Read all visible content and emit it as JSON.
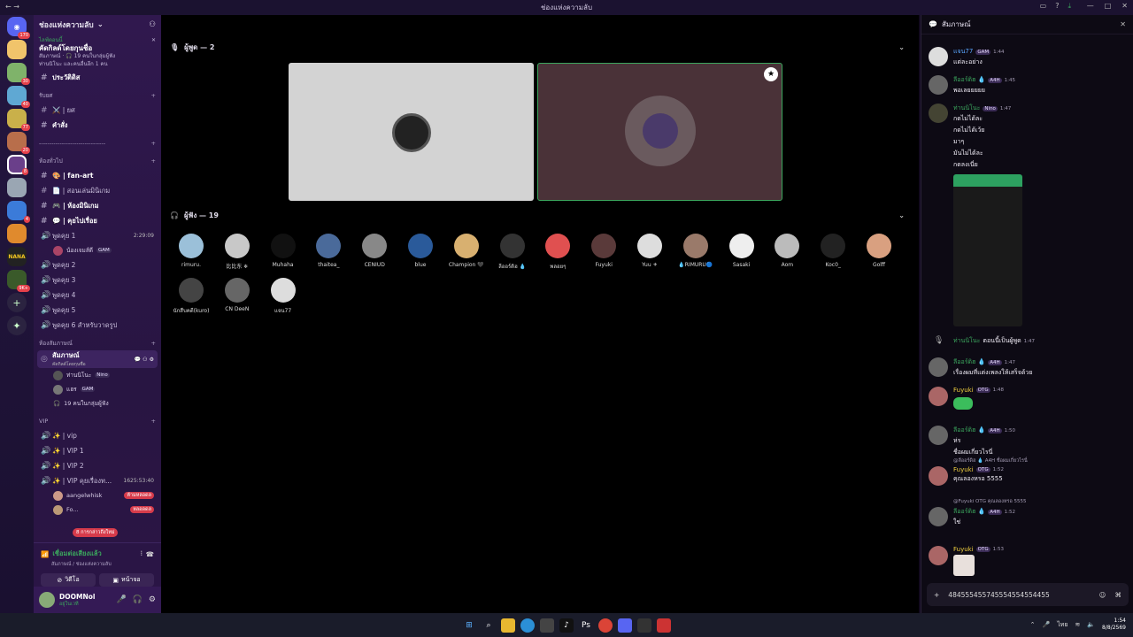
{
  "window": {
    "title": "ช่องแห่งความลับ"
  },
  "guild_badges": [
    "170",
    "30",
    "40",
    "77",
    "20",
    "8",
    "4",
    "9K+"
  ],
  "server": {
    "name": "ช่องแห่งความลับ"
  },
  "event": {
    "status": "ไลฟ์ตอนนี้",
    "title": "คัดกิลด์โดยกุนชื่อ",
    "host": "สัมภาษณ์ · 🎧 19 คนในกลุ่มผู้ฟัง",
    "sub": "ท่านนิโนะ และคนอื่นอีก 1 คน"
  },
  "channels": [
    {
      "name": "ประวัติดิส",
      "bold": true
    },
    {
      "cat": "รับยศ"
    },
    {
      "name": "⚔️ | ยศ"
    },
    {
      "name": "คำสั่ง",
      "bold": true
    },
    {
      "cat": "--------------------------------"
    },
    {
      "cat": "ห้องทั่วไป"
    },
    {
      "name": "🎨 | fan-art",
      "bold": true
    },
    {
      "name": "📄 | สอนเล่นมินิเกม"
    },
    {
      "name": "🎮 | ห้องมินิเกม",
      "bold": true
    },
    {
      "name": "💬 | คุยไปเรื่อย",
      "bold": true
    }
  ],
  "voice_channels": [
    {
      "name": "พูดคุย 1",
      "time": "2:29:09",
      "member": "น้องเจมส์ดี",
      "tag": "GAM"
    },
    {
      "name": "พูดคุย 2"
    },
    {
      "name": "พูดคุย 3"
    },
    {
      "name": "พูดคุย 4"
    },
    {
      "name": "พูดคุย 5"
    },
    {
      "name": "พูดคุย 6 สำหรับวาดรูป"
    }
  ],
  "stage_cat": "ห้องสัมภาษณ์",
  "stage_channel": {
    "name": "สัมภาษณ์",
    "sub": "คัดกิลด์โดยกุนชื่อ"
  },
  "stage_members": [
    {
      "name": "ท่านนิโนะ",
      "tag": "Nino"
    },
    {
      "name": "แฮร",
      "tag": "GAM"
    },
    {
      "name": "19 คนในกลุ่มผู้ฟัง",
      "tag": ""
    }
  ],
  "vip_cat": "VIP",
  "vip": [
    {
      "name": "✨ | vip"
    },
    {
      "name": "✨ | VIP 1"
    },
    {
      "name": "✨ | VIP 2"
    },
    {
      "name": "✨ | VIP คุยเรื่องท...",
      "time": "1625:53:40"
    }
  ],
  "vip_members": [
    {
      "name": "aangelwhisk",
      "tag": "ห้ามหลอดล"
    },
    {
      "name": "Fo...",
      "tag": "หลอดดล"
    }
  ],
  "unread_pill": "8 การกล่าวถึงใหม่",
  "voice_panel": {
    "status": "เชื่อมต่อเสียงแล้ว",
    "sub": "สัมภาษณ์ / ช่องแห่งความลับ",
    "video": "วิดีโอ",
    "screen": "หน้าจอ"
  },
  "user": {
    "name": "DOOMNol",
    "status": "อยู่ในเวที"
  },
  "stage": {
    "speakers_label": "ผู้พูด — 2",
    "audience_label": "ผู้ฟัง — 19"
  },
  "audience": [
    "rimuru.",
    "比比东 ❄",
    "Muhaha",
    "thaitea_",
    "CENIUD",
    "blue",
    "Champion 🖤",
    "ลีออร์ดิฮ 💧",
    "พลอยๆ",
    "Fuyuki",
    "Yuu ⚜",
    "💧RIMURU🔵",
    "Sasaki",
    "Aom",
    "Koc0_",
    "Golff",
    "นักสืบคดี(kuro)",
    "CN DeeN",
    "แจน77"
  ],
  "chat": {
    "title": "สัมภาษณ์",
    "messages": [
      {
        "user": "แจน77",
        "tag": "GAM",
        "time": "1:44",
        "lines": [
          "แต่ละอย่าง"
        ]
      },
      {
        "user": "ลีออร์ดิฮ 💧",
        "tag": "A4H",
        "time": "1:45",
        "lines": [
          "พอเลยยยยย"
        ]
      },
      {
        "user": "ท่านนิโนะ",
        "tag": "Nino",
        "time": "1:47",
        "lines": [
          "กดไม่ได้ละ",
          "กดไม่ได้เว้ย",
          "มาๆ",
          "มันไม่ได้ละ",
          "กดลงเนี่ย"
        ]
      },
      {
        "user": "ท่านนิโนะ",
        "tag": "",
        "time": "1:47",
        "lines": [
          "ตอนนี้เป็นผู้พูด"
        ]
      },
      {
        "user": "ลีออร์ดิฮ 💧",
        "tag": "A4H",
        "time": "1:47",
        "lines": [
          "เรื่องผมที่แต่งเพลงให้เสร็จด้วย"
        ]
      },
      {
        "user": "Fuyuki",
        "tag": "OTG",
        "time": "1:48",
        "lines": []
      },
      {
        "user": "ลีออร์ดิฮ 💧",
        "tag": "A4H",
        "time": "1:50",
        "lines": [
          "ห่ร",
          "ชื่อผมเกี่ยวไรนี่"
        ]
      },
      {
        "reply": "@ลีออร์ดิฮ 💧 A4H ชื่อผมเกี่ยวไรนี่",
        "user": "Fuyuki",
        "tag": "OTG",
        "time": "1:52",
        "lines": [
          "คุณลองหรอ 5555"
        ]
      },
      {
        "reply": "@Fuyuki OTG คุณลองหรอ 5555",
        "user": "ลีออร์ดิฮ 💧",
        "tag": "A4H",
        "time": "1:52",
        "lines": [
          "ใช่"
        ]
      },
      {
        "user": "Fuyuki",
        "tag": "OTG",
        "time": "1:53",
        "lines": []
      }
    ],
    "input_value": "484555455745554554554455"
  },
  "clock": {
    "time": "1:54",
    "date": "8/8/2569",
    "lang": "ไทย"
  }
}
